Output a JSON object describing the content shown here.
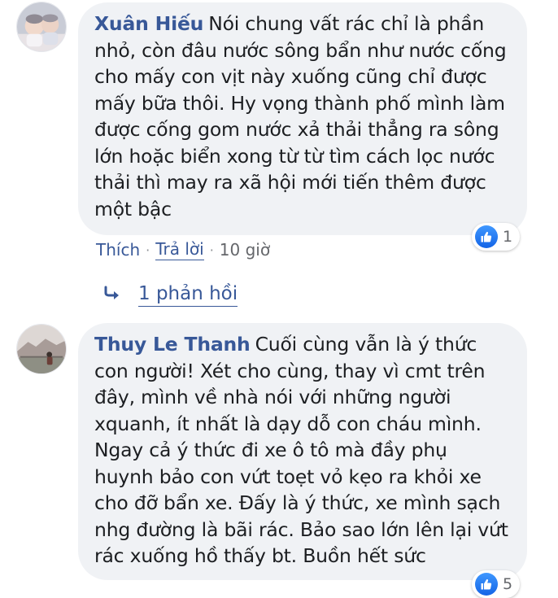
{
  "comments": [
    {
      "author": "Xuân Hiếu",
      "text": "Nói chung vất rác chỉ là phần nhỏ, còn đâu nước sông bẩn như nước cống cho mấy con vịt này xuống cũng chỉ được mấy bữa thôi. Hy vọng thành phố mình làm được cống gom nước xả thải thẳng ra sông lớn hoặc biển xong từ từ tìm cách lọc nước thải thì may ra xã hội mới tiến thêm được một bậc",
      "reaction_count": "1",
      "actions": {
        "like": "Thích",
        "reply": "Trả lời",
        "time": "10 giờ",
        "separator": "·"
      },
      "replies_label": "1 phản hồi"
    },
    {
      "author": "Thuy Le Thanh",
      "text": "Cuối cùng vẫn là ý thức con người! Xét cho cùng, thay vì cmt trên đây, mình về nhà nói với những người xquanh, ít nhất là dạy dỗ con cháu mình. Ngay cả ý thức đi xe ô tô mà đầy phụ huynh bảo con vứt toẹt vỏ kẹo ra khỏi xe cho đỡ bẩn xe. Đấy là ý thức, xe mình sạch nhg đường là bãi rác. Bảo sao lớn lên lại vứt rác xuống hồ thấy bt. Buồn hết sức",
      "reaction_count": "5"
    }
  ],
  "colors": {
    "author": "#385898",
    "bubble": "#f0f2f5",
    "like_blue": "#1877f2",
    "meta_gray": "#65676b"
  },
  "icons": [
    "like-thumb-icon",
    "reply-arrow-icon"
  ]
}
